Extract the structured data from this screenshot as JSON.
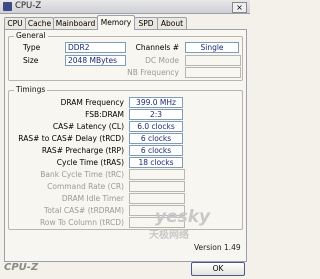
{
  "window": {
    "title": "CPU-Z",
    "close_glyph": "×"
  },
  "tabs": [
    "CPU",
    "Cache",
    "Mainboard",
    "Memory",
    "SPD",
    "About"
  ],
  "active_tab": "Memory",
  "general": {
    "title": "General",
    "type_label": "Type",
    "type_value": "DDR2",
    "size_label": "Size",
    "size_value": "2048 MBytes",
    "channels_label": "Channels #",
    "channels_value": "Single",
    "dc_mode_label": "DC Mode",
    "dc_mode_value": "",
    "nb_freq_label": "NB Frequency",
    "nb_freq_value": ""
  },
  "timings": {
    "title": "Timings",
    "rows": [
      {
        "label": "DRAM Frequency",
        "value": "399.0 MHz"
      },
      {
        "label": "FSB:DRAM",
        "value": "2:3"
      },
      {
        "label": "CAS# Latency (CL)",
        "value": "6.0 clocks"
      },
      {
        "label": "RAS# to CAS# Delay (tRCD)",
        "value": "6 clocks"
      },
      {
        "label": "RAS# Precharge (tRP)",
        "value": "6 clocks"
      },
      {
        "label": "Cycle Time (tRAS)",
        "value": "18 clocks"
      },
      {
        "label": "Bank Cycle Time (tRC)",
        "value": ""
      },
      {
        "label": "Command Rate (CR)",
        "value": ""
      },
      {
        "label": "DRAM Idle Timer",
        "value": ""
      },
      {
        "label": "Total CAS# (tRDRAM)",
        "value": ""
      },
      {
        "label": "Row To Column (tRCD)",
        "value": ""
      }
    ]
  },
  "watermark": {
    "top": "yesky",
    "bottom": "天极网络"
  },
  "version": "Version 1.49",
  "footer": {
    "brand": "CPU-Z",
    "ok_label": "OK"
  }
}
